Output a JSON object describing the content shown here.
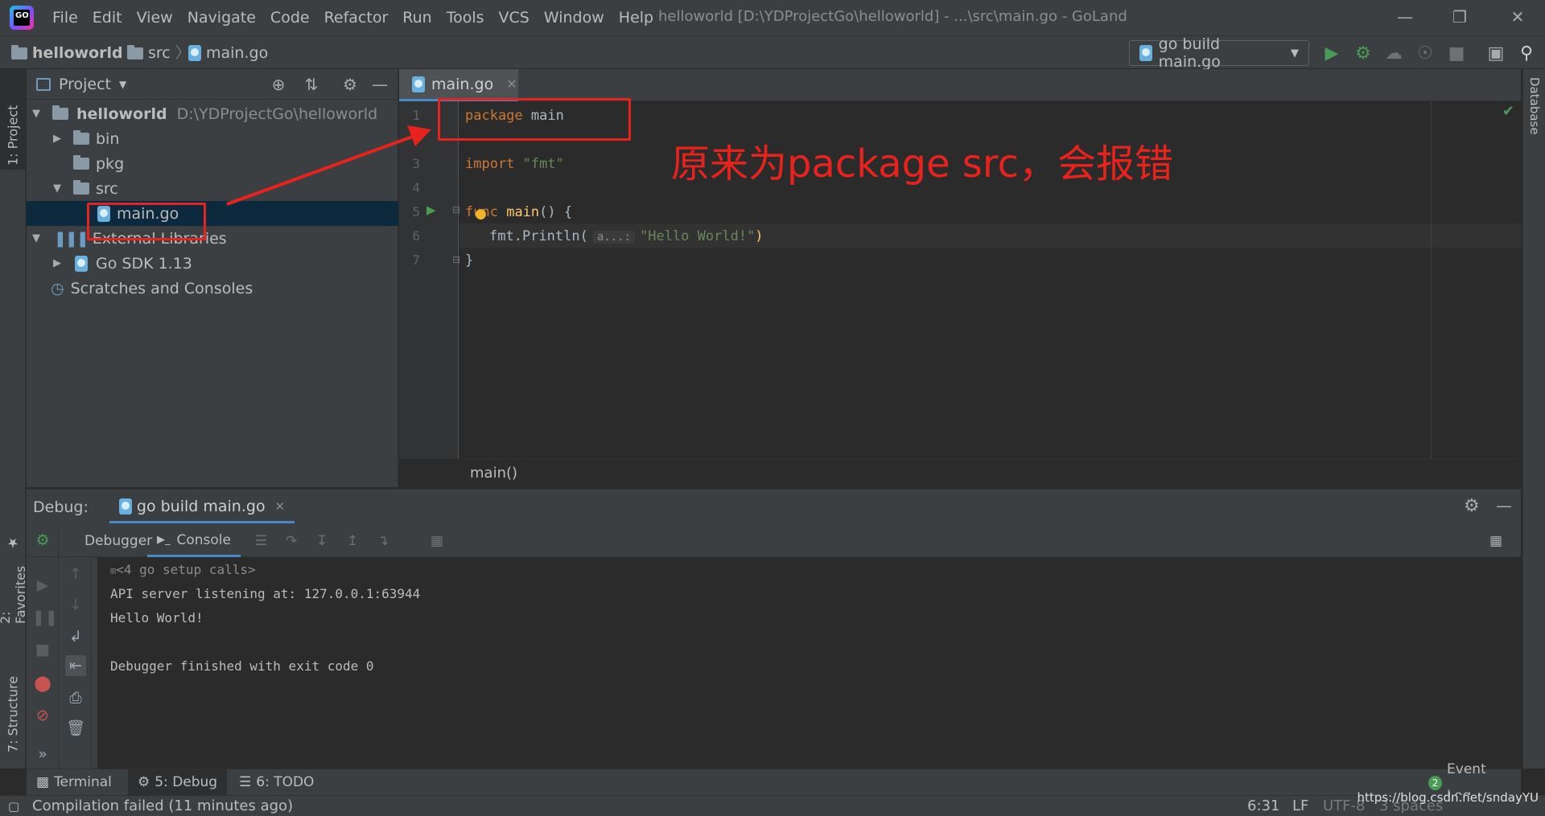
{
  "app": {
    "window_title": "helloworld [D:\\YDProjectGo\\helloworld] - ...\\src\\main.go - GoLand",
    "menu": [
      "File",
      "Edit",
      "View",
      "Navigate",
      "Code",
      "Refactor",
      "Run",
      "Tools",
      "VCS",
      "Window",
      "Help"
    ]
  },
  "navbar": {
    "crumbs": [
      "helloworld",
      "src",
      "main.go"
    ],
    "run_config": "go build main.go"
  },
  "side_tabs": {
    "project": "1: Project",
    "favorites": "2: Favorites",
    "structure": "7: Structure",
    "database": "Database"
  },
  "project": {
    "header": "Project",
    "tree": {
      "root": "helloworld",
      "root_path": "D:\\YDProjectGo\\helloworld",
      "bin": "bin",
      "pkg": "pkg",
      "src": "src",
      "main": "main.go",
      "external": "External Libraries",
      "sdk": "Go SDK 1.13",
      "scratches": "Scratches and Consoles"
    }
  },
  "editor": {
    "tab": "main.go",
    "line_numbers": [
      "1",
      "3",
      "4",
      "5",
      "6",
      "7"
    ],
    "code": {
      "l1_kw": "package",
      "l1_name": "main",
      "l3_kw": "import",
      "l3_str": "\"fmt\"",
      "l5_kw": "func",
      "l5_name": "main",
      "l5_rest": "() {",
      "l6_pre": "fmt.Println(",
      "l6_hint": "a...:",
      "l6_str": "\"Hello World!\"",
      "l6_close": ")",
      "l7": "}"
    },
    "breadcrumb": "main()"
  },
  "annotation": {
    "text": "原来为package src，会报错"
  },
  "debug": {
    "label": "Debug:",
    "session": "go build main.go",
    "tabs": {
      "debugger": "Debugger",
      "console": "Console"
    },
    "console_lines": [
      "<4 go setup calls>",
      "API server listening at: 127.0.0.1:63944",
      "Hello World!",
      "",
      "Debugger finished with exit code 0"
    ]
  },
  "tool_tabs": {
    "terminal": "Terminal",
    "debug": "5: Debug",
    "todo": "6: TODO",
    "event_log": "Event Log",
    "event_count": "2"
  },
  "status": {
    "message": "Compilation failed (11 minutes ago)",
    "position": "6:31",
    "line_sep": "LF",
    "encoding": "UTF-8",
    "indent": "3 spaces",
    "watermark": "https://blog.csdn.net/sndayYU"
  },
  "colors": {
    "annotation_red": "#e8221c",
    "keyword": "#cc7832",
    "function": "#ffc66d",
    "string": "#6a8759",
    "accent_blue": "#4a88c7"
  }
}
